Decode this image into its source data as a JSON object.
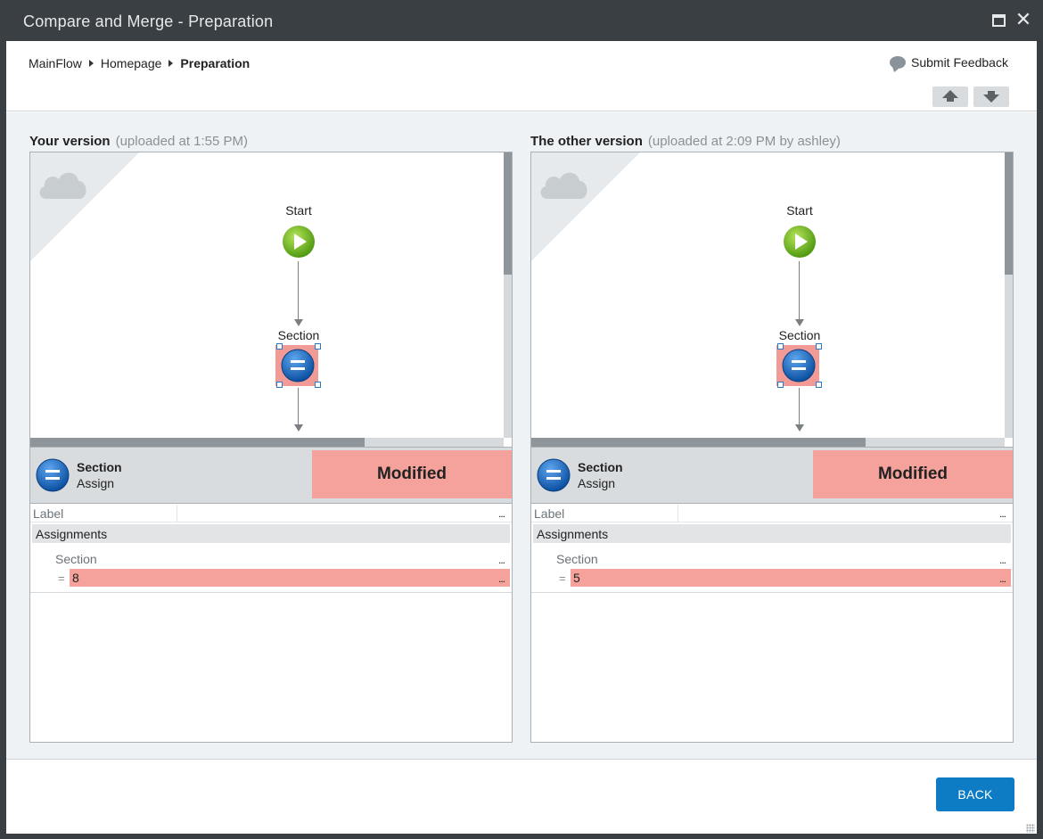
{
  "window": {
    "title": "Compare and Merge - Preparation",
    "maximize_icon": "maximize-icon",
    "close_icon": "close-icon",
    "close_glyph": "✕"
  },
  "header": {
    "breadcrumb": [
      "MainFlow",
      "Homepage",
      "Preparation"
    ],
    "feedback_label": "Submit Feedback",
    "feedback_icon": "speech-bubble-icon",
    "nav_up_icon": "arrow-up-icon",
    "nav_down_icon": "arrow-down-icon"
  },
  "left": {
    "title": "Your version",
    "meta": "(uploaded at 1:55 PM)",
    "flow": {
      "start_label": "Start",
      "section_label": "Section"
    },
    "element": {
      "name": "Section",
      "type": "Assign",
      "status": "Modified"
    },
    "props": {
      "label_key": "Label",
      "label_dots": "...",
      "group": "Assignments",
      "variable": "Section",
      "var_dots": "...",
      "eq": "=",
      "value": "8",
      "value_dots": "..."
    }
  },
  "right": {
    "title": "The other version",
    "meta": "(uploaded at 2:09 PM by ashley)",
    "flow": {
      "start_label": "Start",
      "section_label": "Section"
    },
    "element": {
      "name": "Section",
      "type": "Assign",
      "status": "Modified"
    },
    "props": {
      "label_key": "Label",
      "label_dots": "...",
      "group": "Assignments",
      "variable": "Section",
      "var_dots": "...",
      "eq": "=",
      "value": "5",
      "value_dots": "..."
    }
  },
  "colors": {
    "modified": "#f4a29b",
    "titlebar": "#3a3f44",
    "primary_button": "#0d7cc4",
    "start_node": "#6fb11f",
    "assign_node": "#1f6fc4"
  },
  "footer": {
    "back_label": "BACK"
  }
}
